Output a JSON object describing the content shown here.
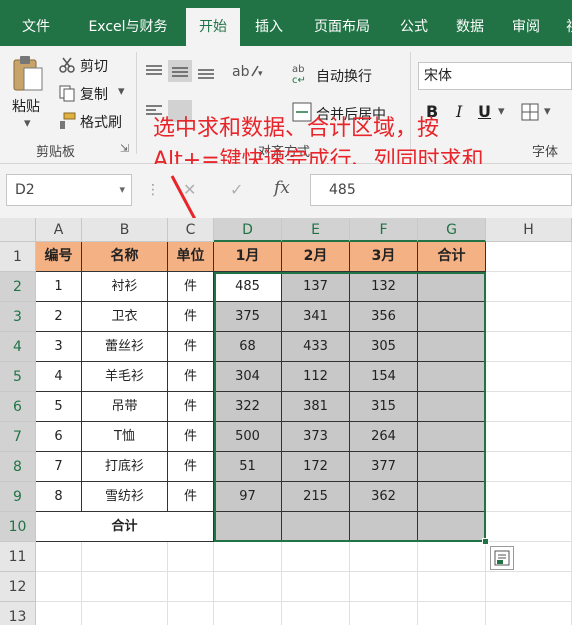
{
  "ribbon": {
    "tabs": [
      "文件",
      "Excel与财务",
      "开始",
      "插入",
      "页面布局",
      "公式",
      "数据",
      "审阅",
      "视"
    ],
    "active_tab": "开始",
    "clipboard": {
      "paste_label": "粘贴",
      "cut_label": "剪切",
      "copy_label": "复制",
      "format_painter_label": "格式刷",
      "group_label": "剪贴板"
    },
    "alignment": {
      "wrap_text_label": "自动换行",
      "merge_label": "合并后居中",
      "group_label": "对齐方式"
    },
    "font": {
      "font_name": "宋体",
      "bold": "B",
      "italic": "I",
      "underline": "U",
      "group_label": "字体"
    }
  },
  "overlay": {
    "line1": "选中求和数据、合计区域，按",
    "line2": "Alt+=键快速完成行、列同时求和"
  },
  "formula_bar": {
    "name_box": "D2",
    "cancel_symbol": "✕",
    "enter_symbol": "✓",
    "fx_label": "fx",
    "value": "485"
  },
  "sheet": {
    "columns": [
      "A",
      "B",
      "C",
      "D",
      "E",
      "F",
      "G",
      "H"
    ],
    "rows": [
      "1",
      "2",
      "3",
      "4",
      "5",
      "6",
      "7",
      "8",
      "9",
      "10",
      "11",
      "12",
      "13"
    ],
    "headers": [
      "编号",
      "名称",
      "单位",
      "1月",
      "2月",
      "3月",
      "合计"
    ],
    "data": [
      [
        "1",
        "衬衫",
        "件",
        "485",
        "137",
        "132",
        ""
      ],
      [
        "2",
        "卫衣",
        "件",
        "375",
        "341",
        "356",
        ""
      ],
      [
        "3",
        "蕾丝衫",
        "件",
        "68",
        "433",
        "305",
        ""
      ],
      [
        "4",
        "羊毛衫",
        "件",
        "304",
        "112",
        "154",
        ""
      ],
      [
        "5",
        "吊带",
        "件",
        "322",
        "381",
        "315",
        ""
      ],
      [
        "6",
        "T恤",
        "件",
        "500",
        "373",
        "264",
        ""
      ],
      [
        "7",
        "打底衫",
        "件",
        "51",
        "172",
        "377",
        ""
      ],
      [
        "8",
        "雪纺衫",
        "件",
        "97",
        "215",
        "362",
        ""
      ]
    ],
    "total_label": "合计"
  },
  "colors": {
    "excel_green": "#217346",
    "header_fill": "#f4b183",
    "selection_fill": "#c8c8c8",
    "overlay_text": "#e8252a"
  }
}
